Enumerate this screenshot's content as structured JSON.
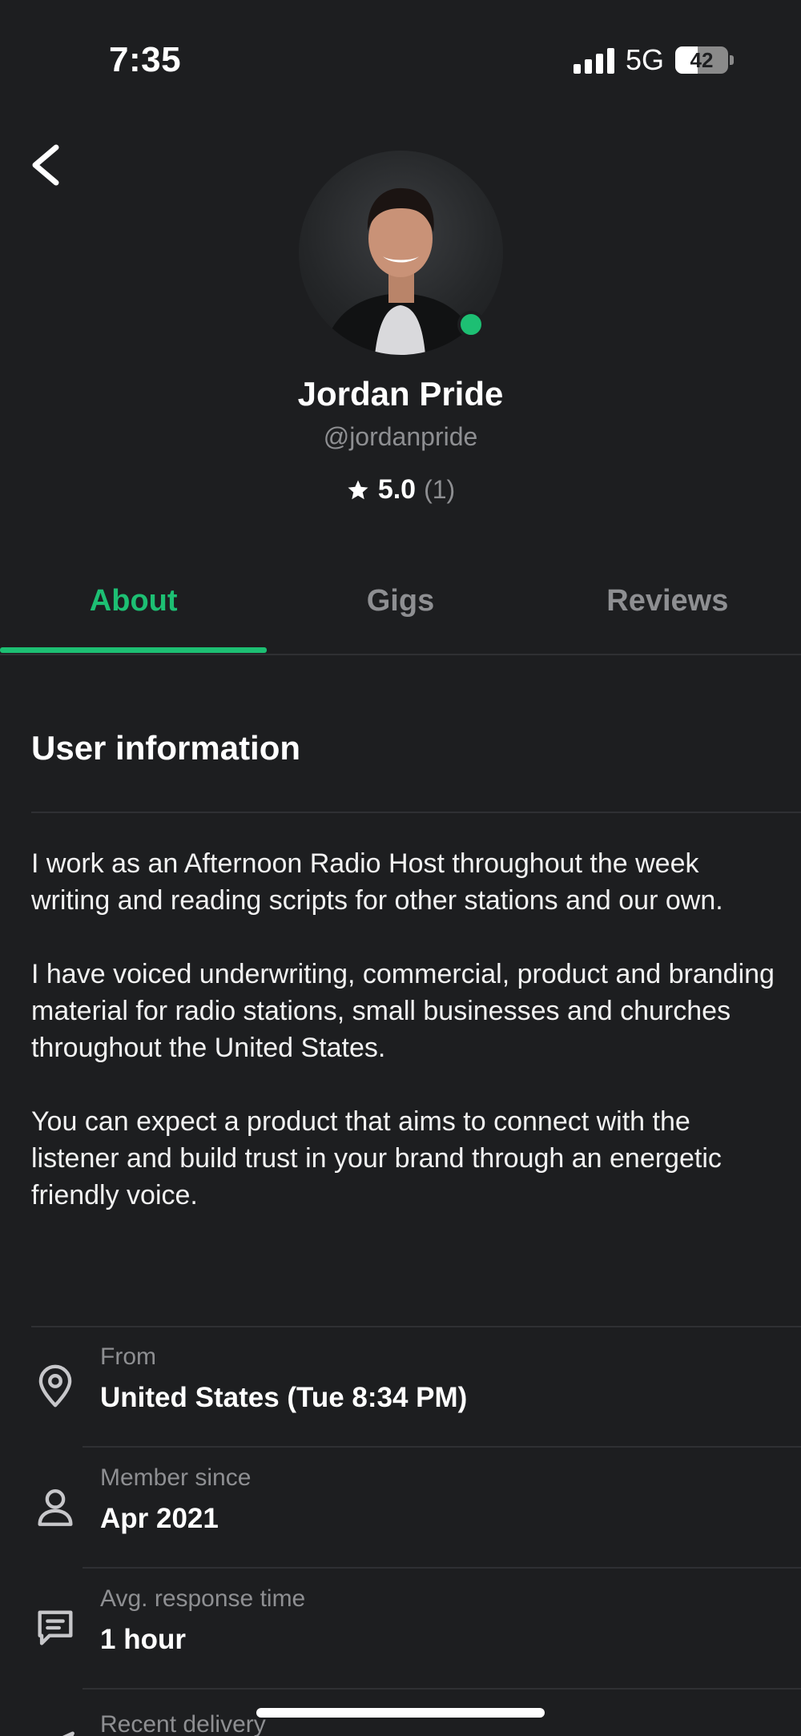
{
  "status_bar": {
    "time": "7:35",
    "network": "5G",
    "battery": "42"
  },
  "profile": {
    "name": "Jordan Pride",
    "handle": "@jordanpride",
    "rating": "5.0",
    "rating_count": "(1)",
    "online": true
  },
  "tabs": [
    {
      "label": "About",
      "active": true
    },
    {
      "label": "Gigs",
      "active": false
    },
    {
      "label": "Reviews",
      "active": false
    }
  ],
  "about": {
    "title": "User information",
    "bio": [
      "I work as an Afternoon Radio Host throughout the week writing and reading scripts for other stations and our own.",
      "I have voiced underwriting, commercial, product and branding material for radio stations, small businesses and churches throughout the United States.",
      "You can expect a product that aims to connect with the listener and build trust in your brand through an energetic friendly voice."
    ]
  },
  "info": [
    {
      "icon": "location-pin-icon",
      "label": "From",
      "value": "United States (Tue 8:34 PM)"
    },
    {
      "icon": "person-icon",
      "label": "Member since",
      "value": "Apr 2021"
    },
    {
      "icon": "chat-bubble-icon",
      "label": "Avg. response time",
      "value": "1 hour"
    },
    {
      "icon": "send-icon",
      "label": "Recent delivery",
      "value": ""
    }
  ],
  "colors": {
    "accent": "#1dbf73",
    "background": "#1d1e20",
    "muted": "#8e8f92"
  }
}
